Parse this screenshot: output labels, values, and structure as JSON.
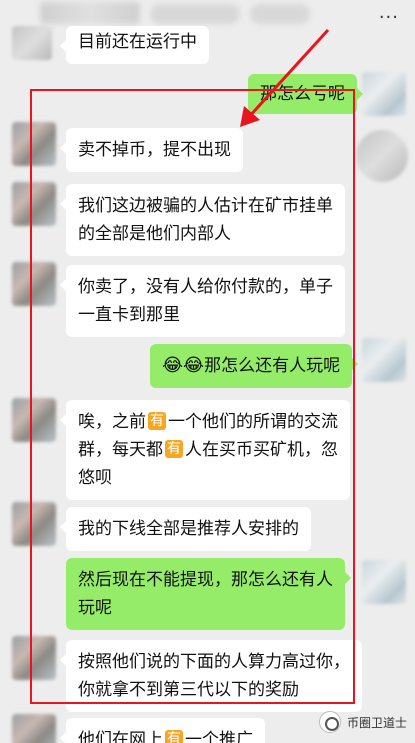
{
  "header": {
    "more_label": "..."
  },
  "messages": [
    {
      "side": "left",
      "text": "目前还在运行中"
    },
    {
      "side": "right",
      "text": "那怎么亏呢"
    },
    {
      "side": "left",
      "text": "卖不掉币，提不出现"
    },
    {
      "side": "left",
      "line1": "我们这边被骗的人估计在矿市挂单",
      "line2": "的全部是他们内部人"
    },
    {
      "side": "left",
      "line1": "你卖了，没有人给你付款的，单子",
      "line2": "一直卡到那里"
    },
    {
      "side": "right",
      "emoji": "😂😂",
      "text": "那怎么还有人玩呢"
    },
    {
      "side": "left",
      "l1a": "唉，之前",
      "tag": "有",
      "l1b": "一个他们的所谓的交流",
      "l2a": "群，每天都",
      "l2b": "人在买币买矿机，忽",
      "line3": "悠呗"
    },
    {
      "side": "left",
      "text": "我的下线全部是推荐人安排的"
    },
    {
      "side": "right",
      "line1": "然后现在不能提现，那怎么还有人",
      "line2": "玩呢"
    },
    {
      "side": "left",
      "line1": "按照他们说的下面的人算力高过你，",
      "line2": "你就拿不到第三代以下的奖励"
    },
    {
      "side": "left",
      "pre": "他们在网上",
      "post": "一个推广"
    }
  ],
  "watermark": {
    "label": "币圈卫道士"
  },
  "colors": {
    "frame": "#e8141e",
    "green_bubble": "#95ec69",
    "tag": "#f5a623"
  }
}
